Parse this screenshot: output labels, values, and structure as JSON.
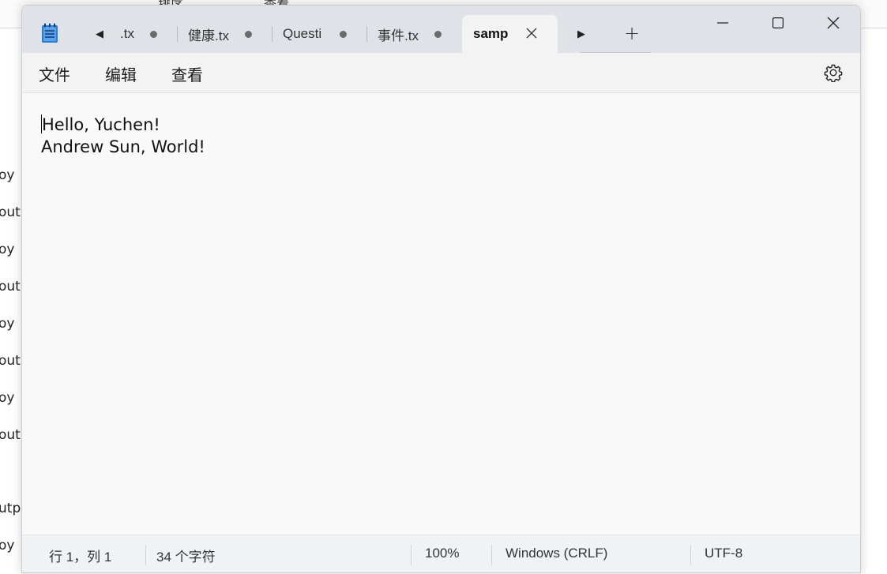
{
  "background": {
    "toolbar_fragments": [
      "排序",
      "查看"
    ],
    "list_items": [
      "oy",
      "out",
      "oy",
      "out",
      "oy",
      "out",
      "oy",
      "out",
      "utp",
      "oy"
    ]
  },
  "window": {
    "tabs": [
      {
        "label": ".tx",
        "modified": true,
        "active": false
      },
      {
        "label": "健康.tx",
        "modified": true,
        "active": false
      },
      {
        "label": "Questi",
        "modified": true,
        "active": false
      },
      {
        "label": "事件.tx",
        "modified": true,
        "active": false
      },
      {
        "label": "samp",
        "modified": false,
        "active": true
      }
    ],
    "new_tab_label": "+",
    "scroll_left_glyph": "◀",
    "scroll_right_glyph": "▶"
  },
  "menu": {
    "file": "文件",
    "edit": "编辑",
    "view": "查看"
  },
  "editor": {
    "lines": [
      "Hello, Yuchen!",
      "Andrew Sun, World!"
    ]
  },
  "status": {
    "position": "行 1，列 1",
    "char_count": "34 个字符",
    "zoom": "100%",
    "line_ending": "Windows (CRLF)",
    "encoding": "UTF-8"
  },
  "colors": {
    "titlebar": "#dfe3e8",
    "active_tab": "#f3f3f3",
    "editor_bg": "#f9f9f9",
    "statusbar": "#f0f2f4",
    "app_icon_blue": "#2b7cd3"
  },
  "icons": {
    "app": "notepad-icon",
    "close_tab": "close-icon",
    "settings": "gear-icon",
    "minimize": "minimize-icon",
    "maximize": "maximize-icon",
    "close_window": "close-icon"
  }
}
